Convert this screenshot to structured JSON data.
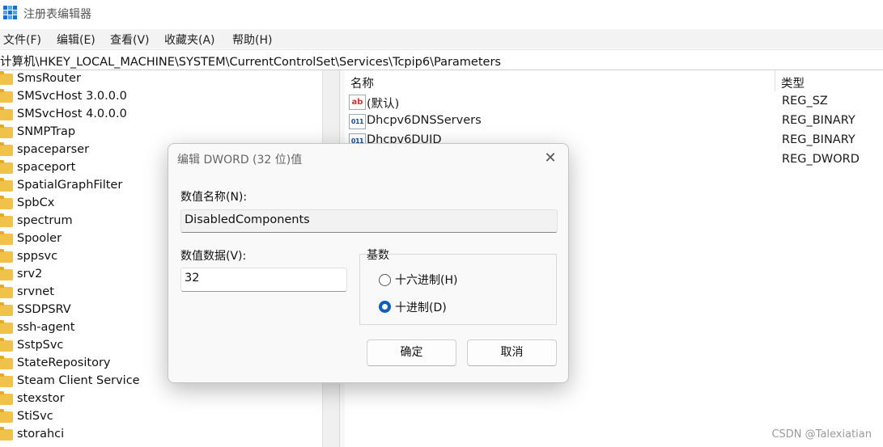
{
  "window": {
    "title": "注册表编辑器"
  },
  "menu": [
    "文件(F)",
    "编辑(E)",
    "查看(V)",
    "收藏夹(A)",
    "帮助(H)"
  ],
  "address": "计算机\\HKEY_LOCAL_MACHINE\\SYSTEM\\CurrentControlSet\\Services\\Tcpip6\\Parameters",
  "tree_items": [
    "SmsRouter",
    "SMSvcHost 3.0.0.0",
    "SMSvcHost 4.0.0.0",
    "SNMPTrap",
    "spaceparser",
    "spaceport",
    "SpatialGraphFilter",
    "SpbCx",
    "spectrum",
    "Spooler",
    "sppsvc",
    "srv2",
    "srvnet",
    "SSDPSRV",
    "ssh-agent",
    "SstpSvc",
    "StateRepository",
    "Steam Client Service",
    "stexstor",
    "StiSvc",
    "storahci"
  ],
  "list": {
    "col_name": "名称",
    "col_type": "类型",
    "rows": [
      {
        "name": "(默认)",
        "type": "REG_SZ",
        "icon": "string-value-icon"
      },
      {
        "name": "Dhcpv6DNSServers",
        "type": "REG_BINARY",
        "icon": "binary-value-icon"
      },
      {
        "name": "Dhcpv6DUID",
        "type": "REG_BINARY",
        "icon": "binary-value-icon"
      },
      {
        "name": "",
        "type": "REG_DWORD",
        "icon": ""
      }
    ]
  },
  "dialog": {
    "title": "编辑 DWORD (32 位)值",
    "value_name_label": "数值名称(N):",
    "value_name": "DisabledComponents",
    "value_data_label": "数值数据(V):",
    "value_data": "32",
    "base_label": "基数",
    "hex_label": "十六进制(H)",
    "dec_label": "十进制(D)",
    "selected_base": "decimal",
    "ok_label": "确定",
    "cancel_label": "取消"
  },
  "watermark": "CSDN @Talexiatian"
}
